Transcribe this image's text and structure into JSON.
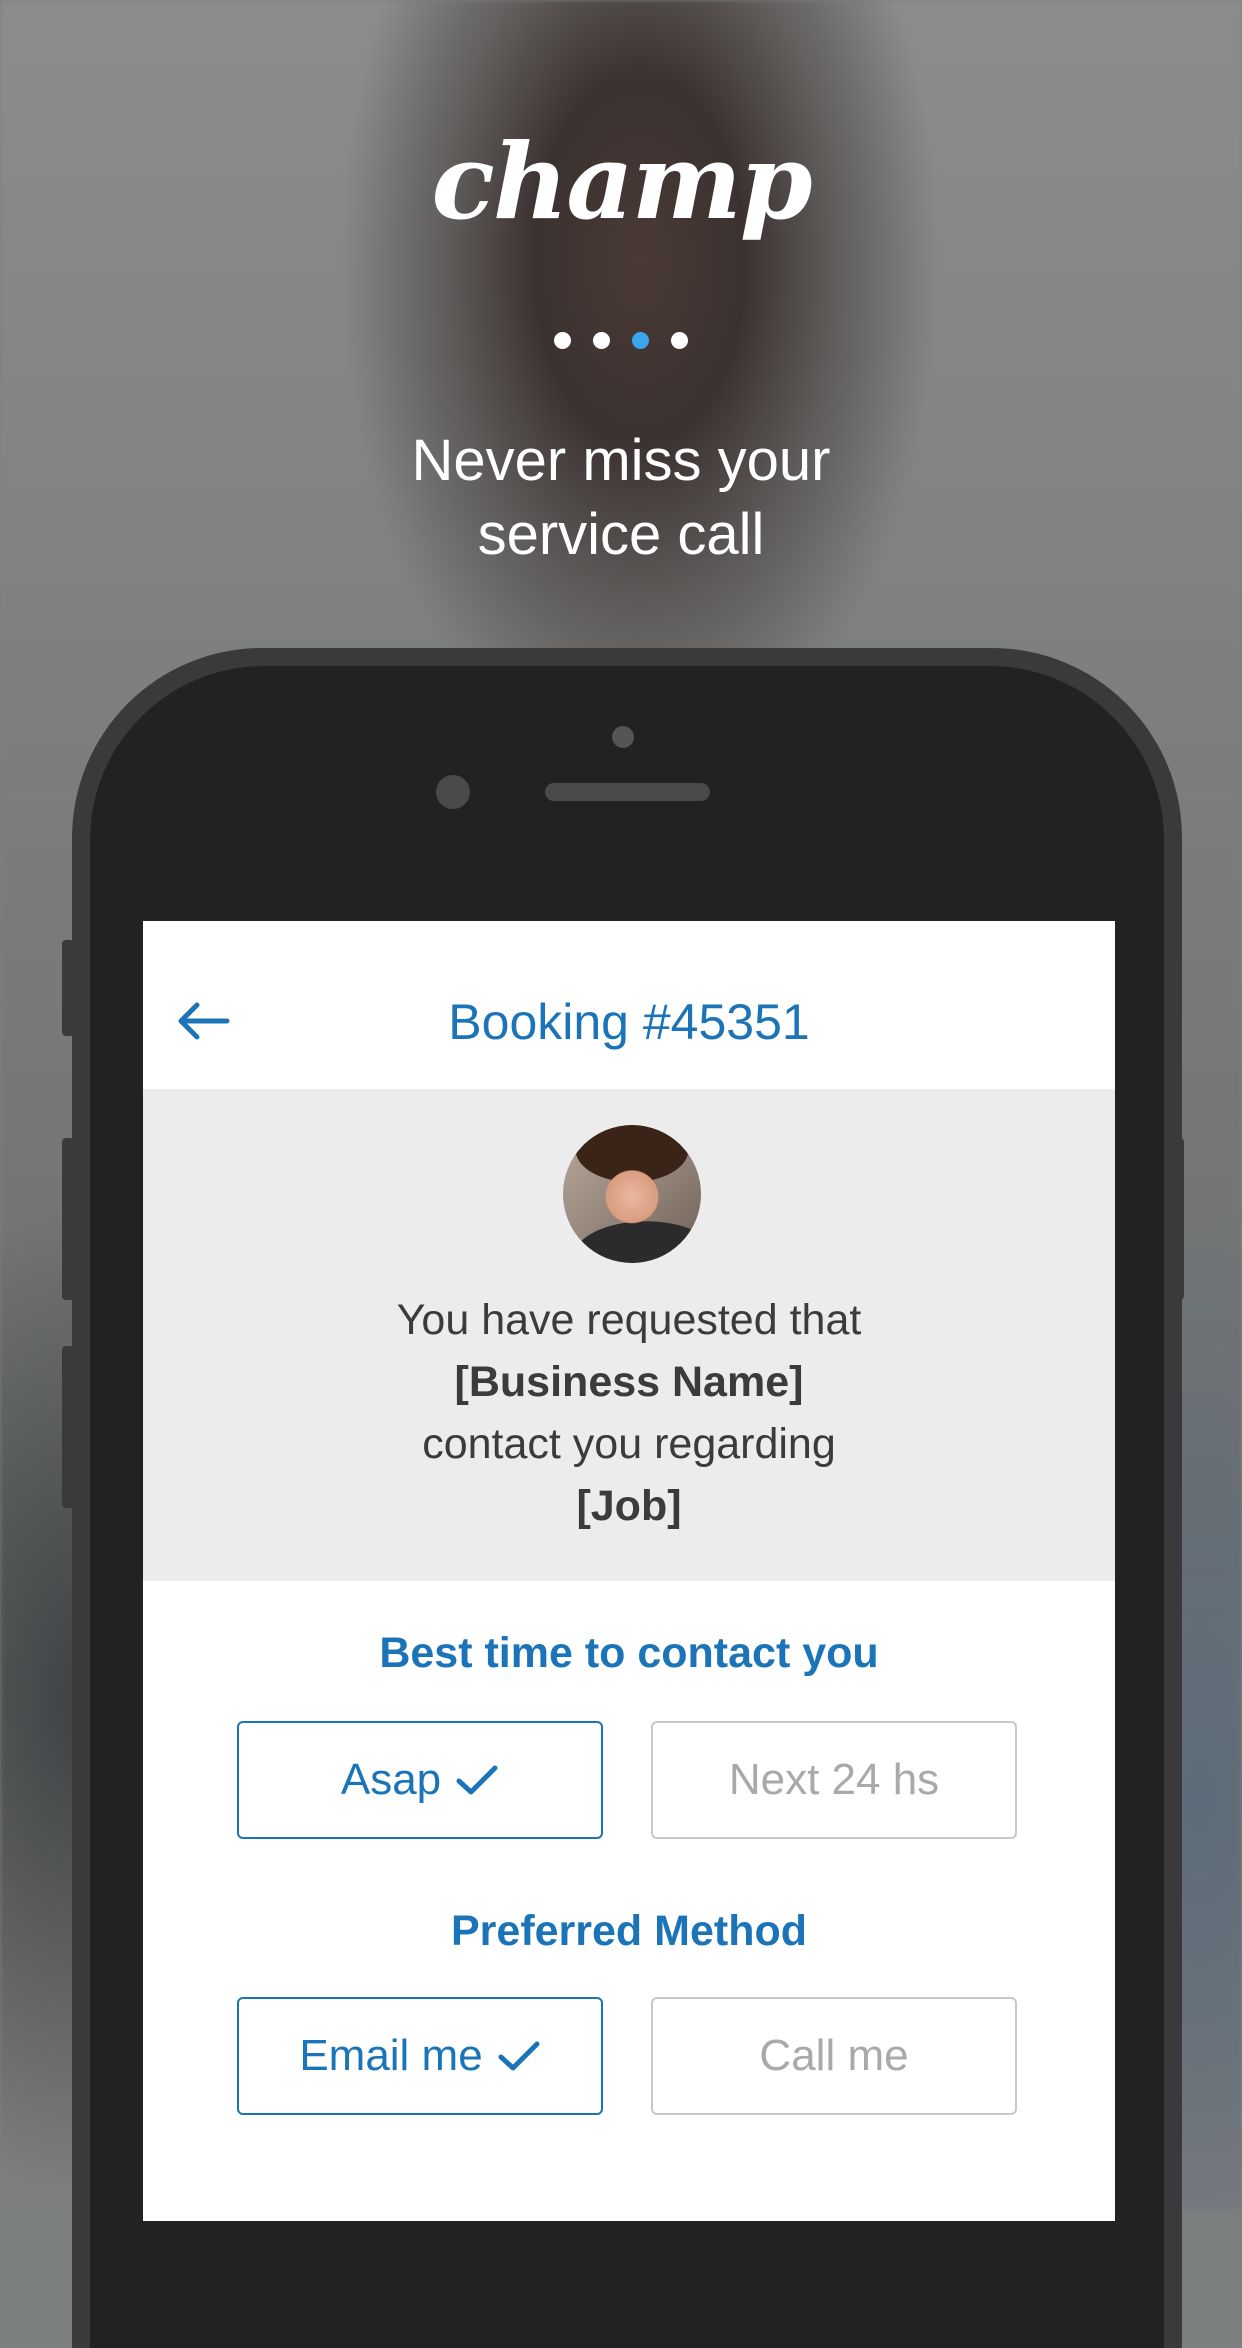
{
  "brand": {
    "logo_text": "champ"
  },
  "pager": {
    "total": 4,
    "active_index": 2,
    "accent_color": "#3aa4ee"
  },
  "tagline": {
    "line1": "Never miss your",
    "line2": "service call"
  },
  "screen": {
    "nav": {
      "back_icon": "arrow-left-icon",
      "title": "Booking #45351"
    },
    "info": {
      "line1": "You have requested that",
      "line2": "[Business Name]",
      "line3": "contact you regarding",
      "line4": "[Job]"
    },
    "contact_time": {
      "title": "Best time to contact you",
      "options": [
        {
          "label": "Asap",
          "selected": true
        },
        {
          "label": "Next 24 hs",
          "selected": false
        }
      ]
    },
    "method": {
      "title": "Preferred Method",
      "options": [
        {
          "label": "Email me",
          "selected": true
        },
        {
          "label": "Call me",
          "selected": false
        }
      ]
    },
    "accent_color": "#1c74b8"
  }
}
